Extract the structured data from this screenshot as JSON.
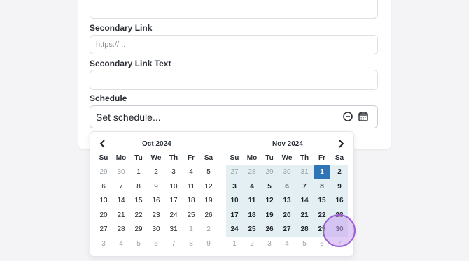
{
  "form": {
    "secondary_link_label": "Secondary Link",
    "secondary_link_placeholder": "https://...",
    "secondary_link_text_label": "Secondary Link Text",
    "schedule_label": "Schedule",
    "schedule_value": "Set schedule..."
  },
  "calendar": {
    "left_month": "Oct 2024",
    "right_month": "Nov 2024",
    "weekdays": [
      "Su",
      "Mo",
      "Tu",
      "We",
      "Th",
      "Fr",
      "Sa"
    ],
    "left_weeks": [
      [
        "29",
        "30",
        "1",
        "2",
        "3",
        "4",
        "5"
      ],
      [
        "6",
        "7",
        "8",
        "9",
        "10",
        "11",
        "12"
      ],
      [
        "13",
        "14",
        "15",
        "16",
        "17",
        "18",
        "19"
      ],
      [
        "20",
        "21",
        "22",
        "23",
        "24",
        "25",
        "26"
      ],
      [
        "27",
        "28",
        "29",
        "30",
        "31",
        "1",
        "2"
      ],
      [
        "3",
        "4",
        "5",
        "6",
        "7",
        "8",
        "9"
      ]
    ],
    "right_weeks": [
      [
        "27",
        "28",
        "29",
        "30",
        "31",
        "1",
        "2"
      ],
      [
        "3",
        "4",
        "5",
        "6",
        "7",
        "8",
        "9"
      ],
      [
        "10",
        "11",
        "12",
        "13",
        "14",
        "15",
        "16"
      ],
      [
        "17",
        "18",
        "19",
        "20",
        "21",
        "22",
        "23"
      ],
      [
        "24",
        "25",
        "26",
        "27",
        "28",
        "29",
        "30"
      ],
      [
        "1",
        "2",
        "3",
        "4",
        "5",
        "6",
        "7"
      ]
    ],
    "selected_day": "1",
    "range_color": "#e3eff2",
    "selected_color": "#2f74b5"
  },
  "icons": {
    "clear": "minus-circle-icon",
    "calendar": "calendar-icon",
    "prev": "chevron-left-icon",
    "next": "chevron-right-icon"
  }
}
